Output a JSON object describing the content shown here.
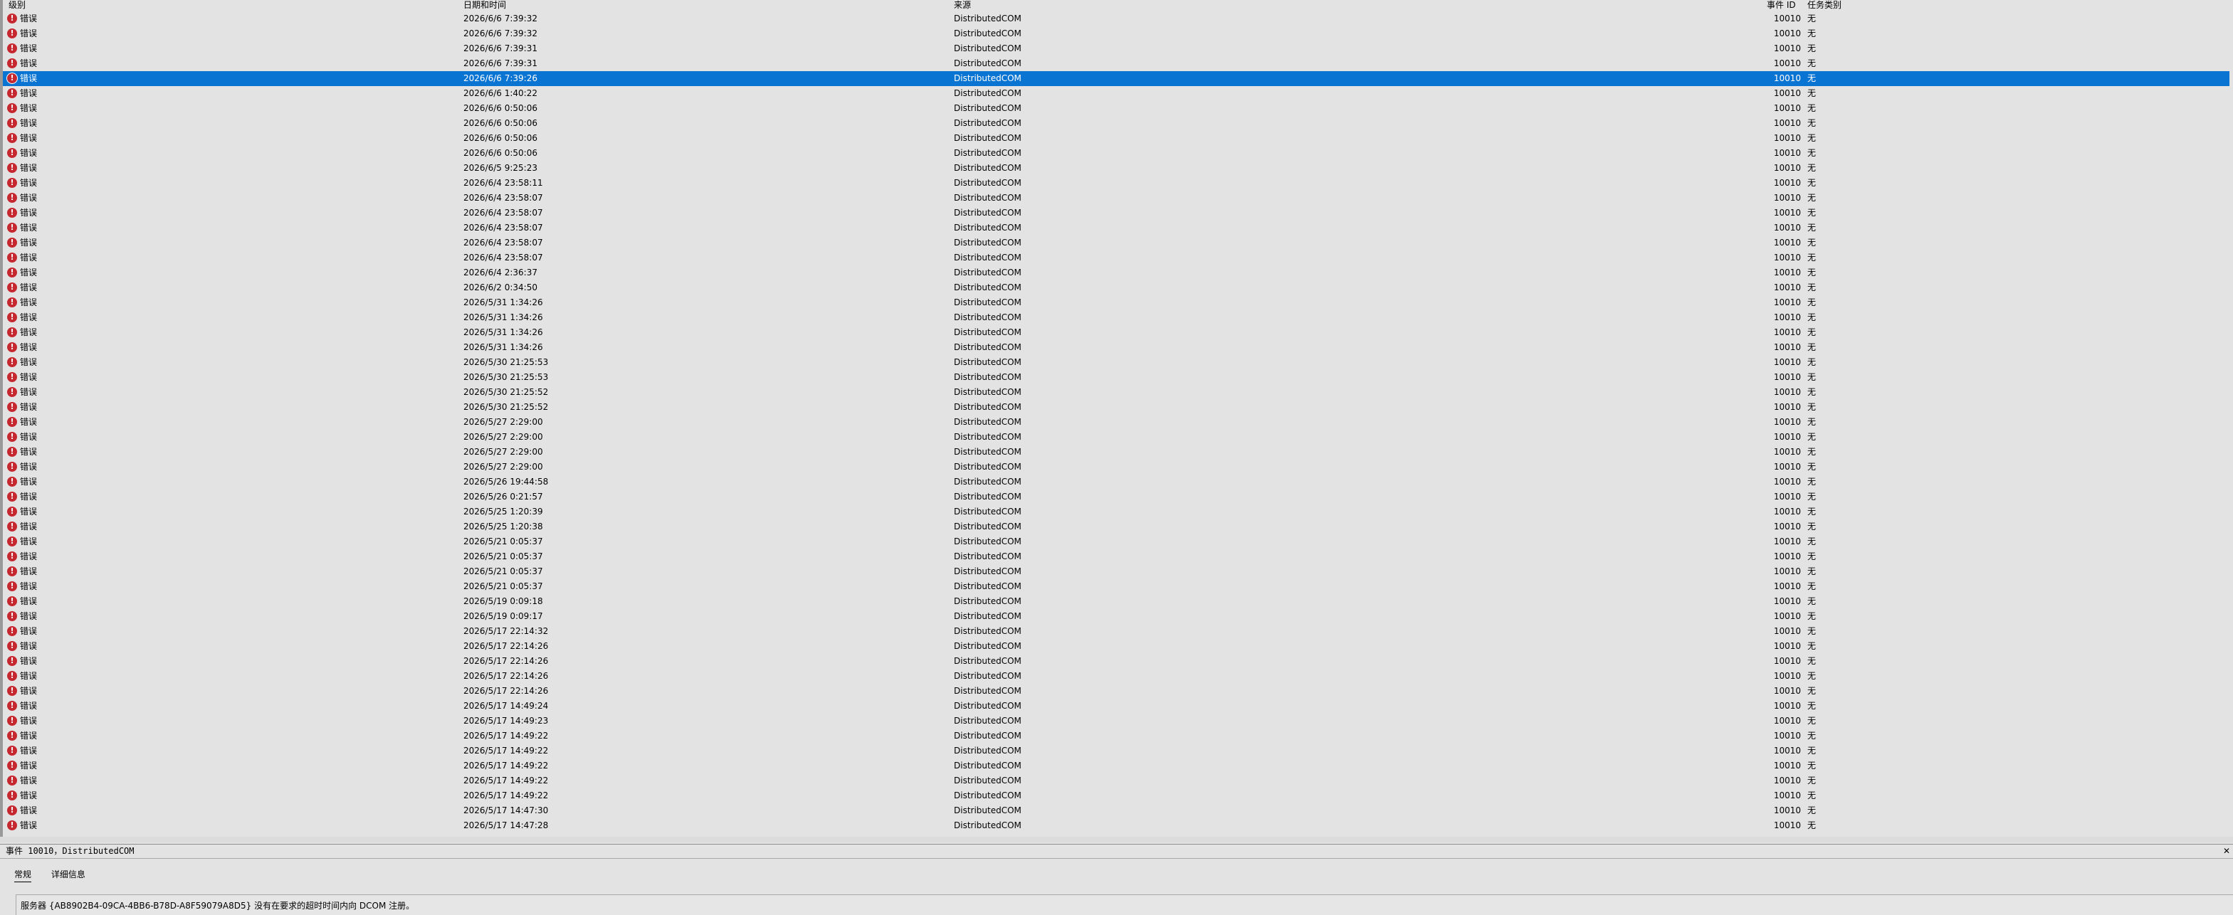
{
  "columns": {
    "level": "级别",
    "date": "日期和时间",
    "source": "来源",
    "event_id": "事件 ID",
    "task": "任务类别"
  },
  "rows": [
    {
      "level": "错误",
      "date": "2026/6/6 7:39:32",
      "source": "DistributedCOM",
      "event_id": "10010",
      "task": "无"
    },
    {
      "level": "错误",
      "date": "2026/6/6 7:39:32",
      "source": "DistributedCOM",
      "event_id": "10010",
      "task": "无"
    },
    {
      "level": "错误",
      "date": "2026/6/6 7:39:31",
      "source": "DistributedCOM",
      "event_id": "10010",
      "task": "无"
    },
    {
      "level": "错误",
      "date": "2026/6/6 7:39:31",
      "source": "DistributedCOM",
      "event_id": "10010",
      "task": "无"
    },
    {
      "level": "错误",
      "date": "2026/6/6 7:39:26",
      "source": "DistributedCOM",
      "event_id": "10010",
      "task": "无",
      "selected": true
    },
    {
      "level": "错误",
      "date": "2026/6/6 1:40:22",
      "source": "DistributedCOM",
      "event_id": "10010",
      "task": "无"
    },
    {
      "level": "错误",
      "date": "2026/6/6 0:50:06",
      "source": "DistributedCOM",
      "event_id": "10010",
      "task": "无"
    },
    {
      "level": "错误",
      "date": "2026/6/6 0:50:06",
      "source": "DistributedCOM",
      "event_id": "10010",
      "task": "无"
    },
    {
      "level": "错误",
      "date": "2026/6/6 0:50:06",
      "source": "DistributedCOM",
      "event_id": "10010",
      "task": "无"
    },
    {
      "level": "错误",
      "date": "2026/6/6 0:50:06",
      "source": "DistributedCOM",
      "event_id": "10010",
      "task": "无"
    },
    {
      "level": "错误",
      "date": "2026/6/5 9:25:23",
      "source": "DistributedCOM",
      "event_id": "10010",
      "task": "无"
    },
    {
      "level": "错误",
      "date": "2026/6/4 23:58:11",
      "source": "DistributedCOM",
      "event_id": "10010",
      "task": "无"
    },
    {
      "level": "错误",
      "date": "2026/6/4 23:58:07",
      "source": "DistributedCOM",
      "event_id": "10010",
      "task": "无"
    },
    {
      "level": "错误",
      "date": "2026/6/4 23:58:07",
      "source": "DistributedCOM",
      "event_id": "10010",
      "task": "无"
    },
    {
      "level": "错误",
      "date": "2026/6/4 23:58:07",
      "source": "DistributedCOM",
      "event_id": "10010",
      "task": "无"
    },
    {
      "level": "错误",
      "date": "2026/6/4 23:58:07",
      "source": "DistributedCOM",
      "event_id": "10010",
      "task": "无"
    },
    {
      "level": "错误",
      "date": "2026/6/4 23:58:07",
      "source": "DistributedCOM",
      "event_id": "10010",
      "task": "无"
    },
    {
      "level": "错误",
      "date": "2026/6/4 2:36:37",
      "source": "DistributedCOM",
      "event_id": "10010",
      "task": "无"
    },
    {
      "level": "错误",
      "date": "2026/6/2 0:34:50",
      "source": "DistributedCOM",
      "event_id": "10010",
      "task": "无"
    },
    {
      "level": "错误",
      "date": "2026/5/31 1:34:26",
      "source": "DistributedCOM",
      "event_id": "10010",
      "task": "无"
    },
    {
      "level": "错误",
      "date": "2026/5/31 1:34:26",
      "source": "DistributedCOM",
      "event_id": "10010",
      "task": "无"
    },
    {
      "level": "错误",
      "date": "2026/5/31 1:34:26",
      "source": "DistributedCOM",
      "event_id": "10010",
      "task": "无"
    },
    {
      "level": "错误",
      "date": "2026/5/31 1:34:26",
      "source": "DistributedCOM",
      "event_id": "10010",
      "task": "无"
    },
    {
      "level": "错误",
      "date": "2026/5/30 21:25:53",
      "source": "DistributedCOM",
      "event_id": "10010",
      "task": "无"
    },
    {
      "level": "错误",
      "date": "2026/5/30 21:25:53",
      "source": "DistributedCOM",
      "event_id": "10010",
      "task": "无"
    },
    {
      "level": "错误",
      "date": "2026/5/30 21:25:52",
      "source": "DistributedCOM",
      "event_id": "10010",
      "task": "无"
    },
    {
      "level": "错误",
      "date": "2026/5/30 21:25:52",
      "source": "DistributedCOM",
      "event_id": "10010",
      "task": "无"
    },
    {
      "level": "错误",
      "date": "2026/5/27 2:29:00",
      "source": "DistributedCOM",
      "event_id": "10010",
      "task": "无"
    },
    {
      "level": "错误",
      "date": "2026/5/27 2:29:00",
      "source": "DistributedCOM",
      "event_id": "10010",
      "task": "无"
    },
    {
      "level": "错误",
      "date": "2026/5/27 2:29:00",
      "source": "DistributedCOM",
      "event_id": "10010",
      "task": "无"
    },
    {
      "level": "错误",
      "date": "2026/5/27 2:29:00",
      "source": "DistributedCOM",
      "event_id": "10010",
      "task": "无"
    },
    {
      "level": "错误",
      "date": "2026/5/26 19:44:58",
      "source": "DistributedCOM",
      "event_id": "10010",
      "task": "无"
    },
    {
      "level": "错误",
      "date": "2026/5/26 0:21:57",
      "source": "DistributedCOM",
      "event_id": "10010",
      "task": "无"
    },
    {
      "level": "错误",
      "date": "2026/5/25 1:20:39",
      "source": "DistributedCOM",
      "event_id": "10010",
      "task": "无"
    },
    {
      "level": "错误",
      "date": "2026/5/25 1:20:38",
      "source": "DistributedCOM",
      "event_id": "10010",
      "task": "无"
    },
    {
      "level": "错误",
      "date": "2026/5/21 0:05:37",
      "source": "DistributedCOM",
      "event_id": "10010",
      "task": "无"
    },
    {
      "level": "错误",
      "date": "2026/5/21 0:05:37",
      "source": "DistributedCOM",
      "event_id": "10010",
      "task": "无"
    },
    {
      "level": "错误",
      "date": "2026/5/21 0:05:37",
      "source": "DistributedCOM",
      "event_id": "10010",
      "task": "无"
    },
    {
      "level": "错误",
      "date": "2026/5/21 0:05:37",
      "source": "DistributedCOM",
      "event_id": "10010",
      "task": "无"
    },
    {
      "level": "错误",
      "date": "2026/5/19 0:09:18",
      "source": "DistributedCOM",
      "event_id": "10010",
      "task": "无"
    },
    {
      "level": "错误",
      "date": "2026/5/19 0:09:17",
      "source": "DistributedCOM",
      "event_id": "10010",
      "task": "无"
    },
    {
      "level": "错误",
      "date": "2026/5/17 22:14:32",
      "source": "DistributedCOM",
      "event_id": "10010",
      "task": "无"
    },
    {
      "level": "错误",
      "date": "2026/5/17 22:14:26",
      "source": "DistributedCOM",
      "event_id": "10010",
      "task": "无"
    },
    {
      "level": "错误",
      "date": "2026/5/17 22:14:26",
      "source": "DistributedCOM",
      "event_id": "10010",
      "task": "无"
    },
    {
      "level": "错误",
      "date": "2026/5/17 22:14:26",
      "source": "DistributedCOM",
      "event_id": "10010",
      "task": "无"
    },
    {
      "level": "错误",
      "date": "2026/5/17 22:14:26",
      "source": "DistributedCOM",
      "event_id": "10010",
      "task": "无"
    },
    {
      "level": "错误",
      "date": "2026/5/17 14:49:24",
      "source": "DistributedCOM",
      "event_id": "10010",
      "task": "无"
    },
    {
      "level": "错误",
      "date": "2026/5/17 14:49:23",
      "source": "DistributedCOM",
      "event_id": "10010",
      "task": "无"
    },
    {
      "level": "错误",
      "date": "2026/5/17 14:49:22",
      "source": "DistributedCOM",
      "event_id": "10010",
      "task": "无"
    },
    {
      "level": "错误",
      "date": "2026/5/17 14:49:22",
      "source": "DistributedCOM",
      "event_id": "10010",
      "task": "无"
    },
    {
      "level": "错误",
      "date": "2026/5/17 14:49:22",
      "source": "DistributedCOM",
      "event_id": "10010",
      "task": "无"
    },
    {
      "level": "错误",
      "date": "2026/5/17 14:49:22",
      "source": "DistributedCOM",
      "event_id": "10010",
      "task": "无"
    },
    {
      "level": "错误",
      "date": "2026/5/17 14:49:22",
      "source": "DistributedCOM",
      "event_id": "10010",
      "task": "无"
    },
    {
      "level": "错误",
      "date": "2026/5/17 14:47:30",
      "source": "DistributedCOM",
      "event_id": "10010",
      "task": "无"
    },
    {
      "level": "错误",
      "date": "2026/5/17 14:47:28",
      "source": "DistributedCOM",
      "event_id": "10010",
      "task": "无"
    }
  ],
  "details": {
    "title": "事件 10010，DistributedCOM",
    "collapse_glyph": "✕",
    "tabs": [
      "常规",
      "详细信息"
    ],
    "message": "服务器 {AB8902B4-09CA-4BB6-B78D-A8F59079A8D5} 没有在要求的超时时间内向 DCOM 注册。"
  },
  "colors": {
    "selection": "#0a74d3",
    "error_icon": "#c6282f",
    "background": "#e3e3e3"
  },
  "icons": {
    "level": "error-icon",
    "collapse": "close-icon"
  }
}
